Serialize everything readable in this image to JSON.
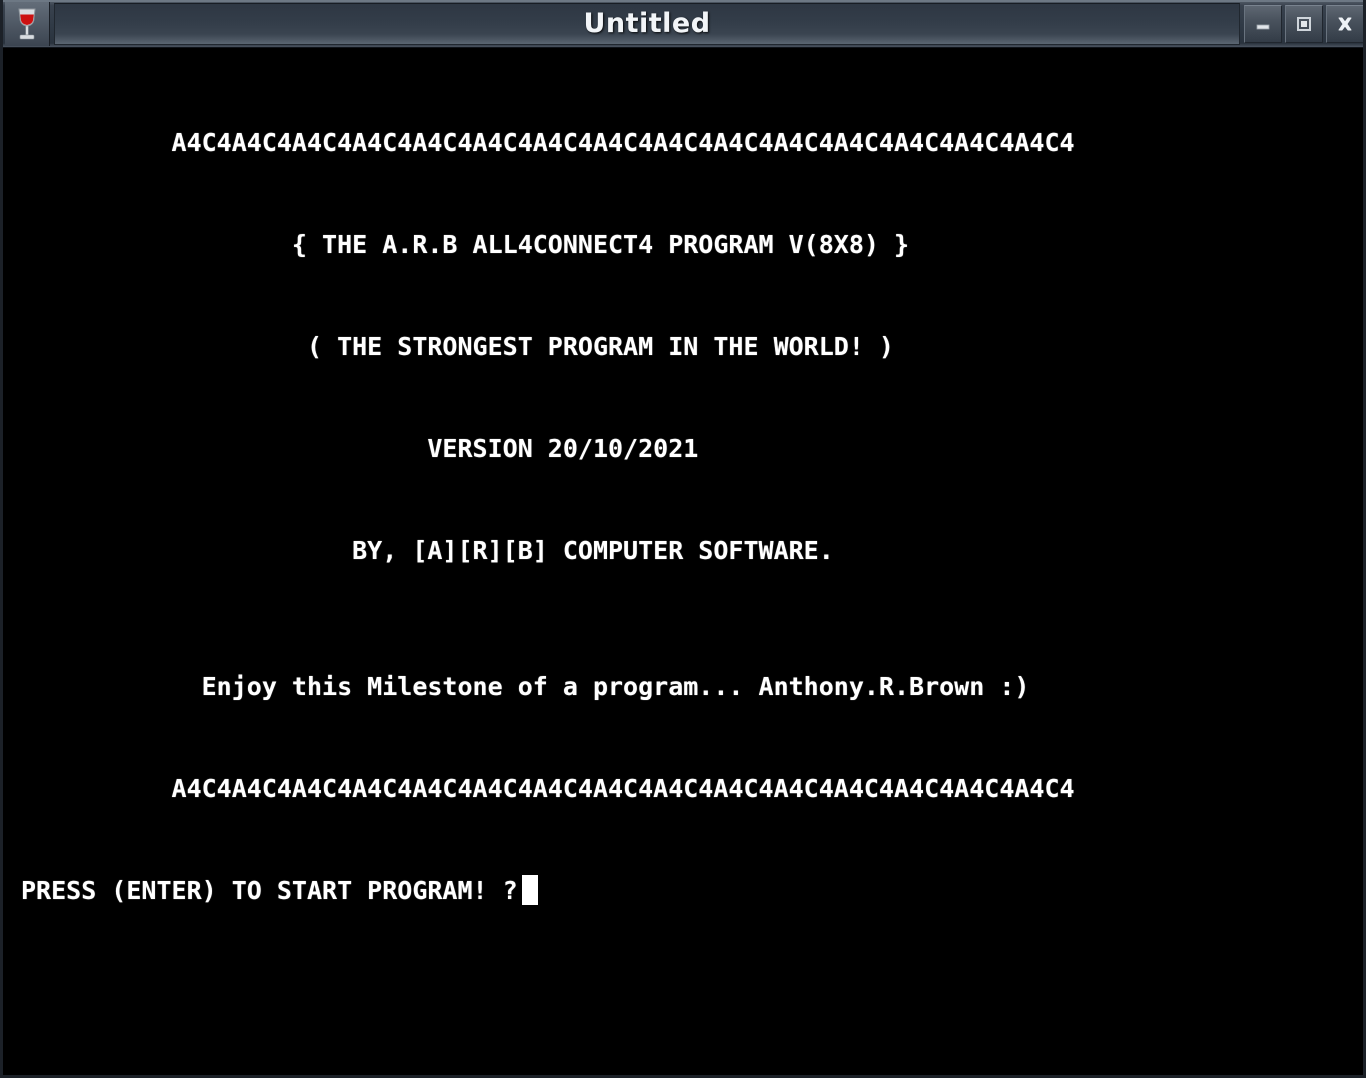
{
  "window": {
    "title": "Untitled",
    "app_icon": "wine-glass-icon",
    "controls": {
      "minimize_label": "Minimize",
      "maximize_label": "Maximize",
      "close_label": "Close"
    },
    "colors": {
      "titlebar_top": "#555e69",
      "titlebar_bottom": "#2a333e",
      "console_background": "#000000",
      "console_text": "#ffffff",
      "icon_red": "#cc1111"
    }
  },
  "console": {
    "lines": [
      "",
      "",
      "          A4C4A4C4A4C4A4C4A4C4A4C4A4C4A4C4A4C4A4C4A4C4A4C4A4C4A4C4A4C4",
      "",
      "",
      "                  { THE A.R.B ALL4CONNECT4 PROGRAM V(8X8) }",
      "",
      "",
      "                   ( THE STRONGEST PROGRAM IN THE WORLD! )",
      "",
      "",
      "                           VERSION 20/10/2021",
      "",
      "",
      "                      BY, [A][R][B] COMPUTER SOFTWARE.",
      "",
      "",
      "",
      "            Enjoy this Milestone of a program... Anthony.R.Brown :)",
      "",
      "",
      "          A4C4A4C4A4C4A4C4A4C4A4C4A4C4A4C4A4C4A4C4A4C4A4C4A4C4A4C4A4C4",
      "",
      ""
    ],
    "prompt": "PRESS (ENTER) TO START PROGRAM! ?",
    "cursor": "block-cursor",
    "banner_pattern": "A4C4",
    "banner_repeat_count": 15,
    "title_line": "{ THE A.R.B ALL4CONNECT4 PROGRAM V(8X8) }",
    "tagline": "( THE STRONGEST PROGRAM IN THE WORLD! )",
    "version": "VERSION 20/10/2021",
    "author": "BY, [A][R][B] COMPUTER SOFTWARE.",
    "message": "Enjoy this Milestone of a program... Anthony.R.Brown :)"
  }
}
